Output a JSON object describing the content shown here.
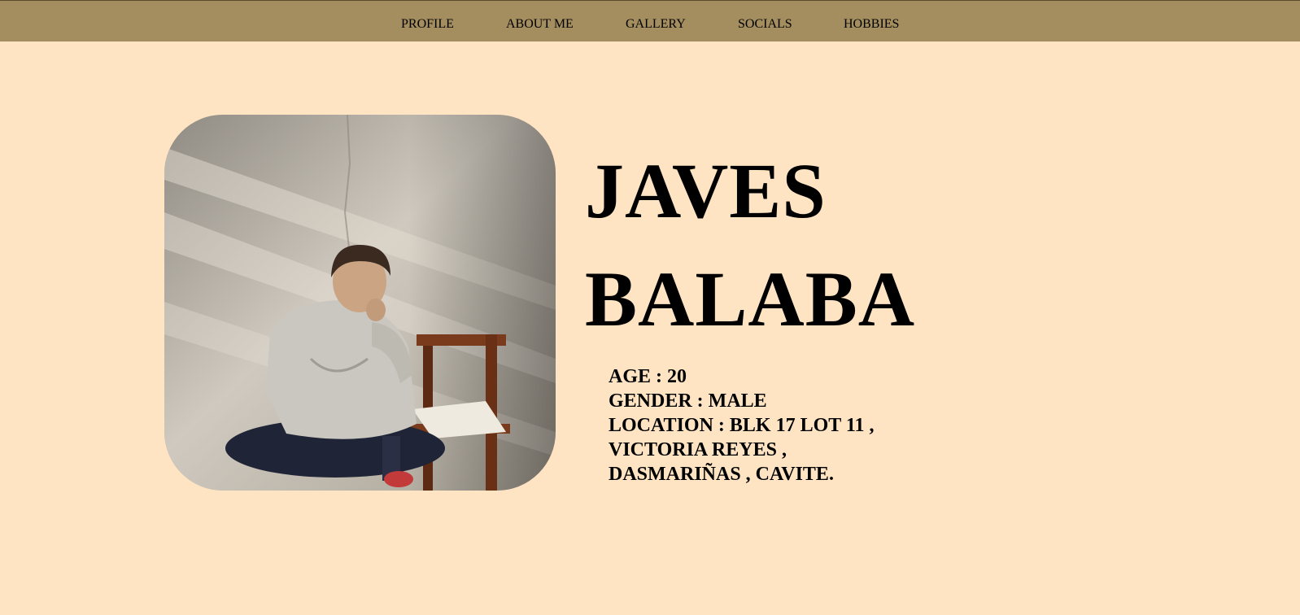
{
  "nav": {
    "items": [
      {
        "label": "PROFILE"
      },
      {
        "label": "ABOUT ME"
      },
      {
        "label": "GALLERY"
      },
      {
        "label": "SOCIALS"
      },
      {
        "label": "HOBBIES"
      }
    ]
  },
  "profile": {
    "first_name": "JAVES",
    "last_name": "BALABA",
    "details": [
      "AGE : 20",
      "GENDER : MALE",
      "LOCATION : BLK 17 LOT 11 ,",
      "VICTORIA REYES ,",
      "DASMARIÑAS , CAVITE."
    ]
  },
  "colors": {
    "page_background": "#fee4c3",
    "navbar_background": "#a48e60",
    "text": "#000000"
  }
}
